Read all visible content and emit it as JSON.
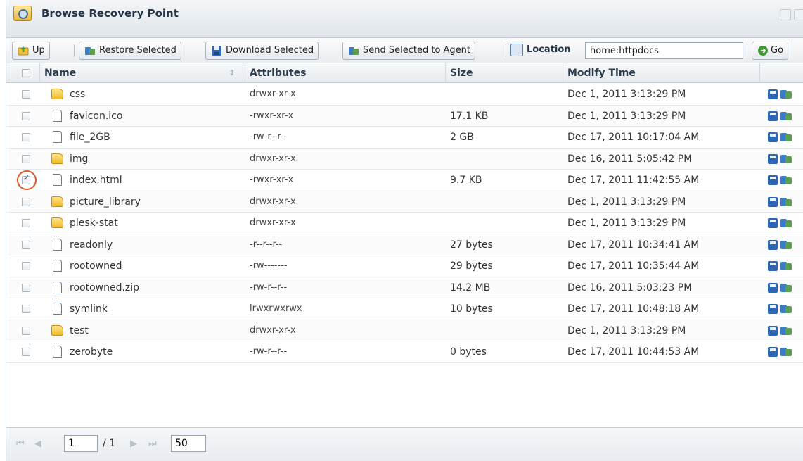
{
  "window": {
    "title": "Browse Recovery Point"
  },
  "toolbar": {
    "up_label": "Up",
    "restore_label": "Restore Selected",
    "download_label": "Download Selected",
    "send_label": "Send Selected to Agent",
    "location_label": "Location",
    "location_value": "home:httpdocs",
    "go_label": "Go"
  },
  "columns": {
    "name": "Name",
    "attributes": "Attributes",
    "size": "Size",
    "modify_time": "Modify Time"
  },
  "rows": [
    {
      "type": "folder",
      "name": "css",
      "attributes": "drwxr-xr-x",
      "size": "",
      "modified": "Dec 1, 2011 3:13:29 PM",
      "checked": false
    },
    {
      "type": "file",
      "name": "favicon.ico",
      "attributes": "-rwxr-xr-x",
      "size": "17.1 KB",
      "modified": "Dec 1, 2011 3:13:29 PM",
      "checked": false
    },
    {
      "type": "file",
      "name": "file_2GB",
      "attributes": "-rw-r--r--",
      "size": "2 GB",
      "modified": "Dec 17, 2011 10:17:04 AM",
      "checked": false
    },
    {
      "type": "folder",
      "name": "img",
      "attributes": "drwxr-xr-x",
      "size": "",
      "modified": "Dec 16, 2011 5:05:42 PM",
      "checked": false
    },
    {
      "type": "file",
      "name": "index.html",
      "attributes": "-rwxr-xr-x",
      "size": "9.7 KB",
      "modified": "Dec 17, 2011 11:42:55 AM",
      "checked": true
    },
    {
      "type": "folder",
      "name": "picture_library",
      "attributes": "drwxr-xr-x",
      "size": "",
      "modified": "Dec 1, 2011 3:13:29 PM",
      "checked": false
    },
    {
      "type": "folder",
      "name": "plesk-stat",
      "attributes": "drwxr-xr-x",
      "size": "",
      "modified": "Dec 1, 2011 3:13:29 PM",
      "checked": false
    },
    {
      "type": "file",
      "name": "readonly",
      "attributes": "-r--r--r--",
      "size": "27 bytes",
      "modified": "Dec 17, 2011 10:34:41 AM",
      "checked": false
    },
    {
      "type": "file",
      "name": "rootowned",
      "attributes": "-rw-------",
      "size": "29 bytes",
      "modified": "Dec 17, 2011 10:35:44 AM",
      "checked": false
    },
    {
      "type": "file",
      "name": "rootowned.zip",
      "attributes": "-rw-r--r--",
      "size": "14.2 MB",
      "modified": "Dec 16, 2011 5:03:23 PM",
      "checked": false
    },
    {
      "type": "file",
      "name": "symlink",
      "attributes": "lrwxrwxrwx",
      "size": "10 bytes",
      "modified": "Dec 17, 2011 10:48:18 AM",
      "checked": false
    },
    {
      "type": "folder",
      "name": "test",
      "attributes": "drwxr-xr-x",
      "size": "",
      "modified": "Dec 1, 2011 3:13:29 PM",
      "checked": false
    },
    {
      "type": "file",
      "name": "zerobyte",
      "attributes": "-rw-r--r--",
      "size": "0 bytes",
      "modified": "Dec 17, 2011 10:44:53 AM",
      "checked": false
    }
  ],
  "pager": {
    "page": "1",
    "total": "/ 1",
    "page_size": "50"
  }
}
